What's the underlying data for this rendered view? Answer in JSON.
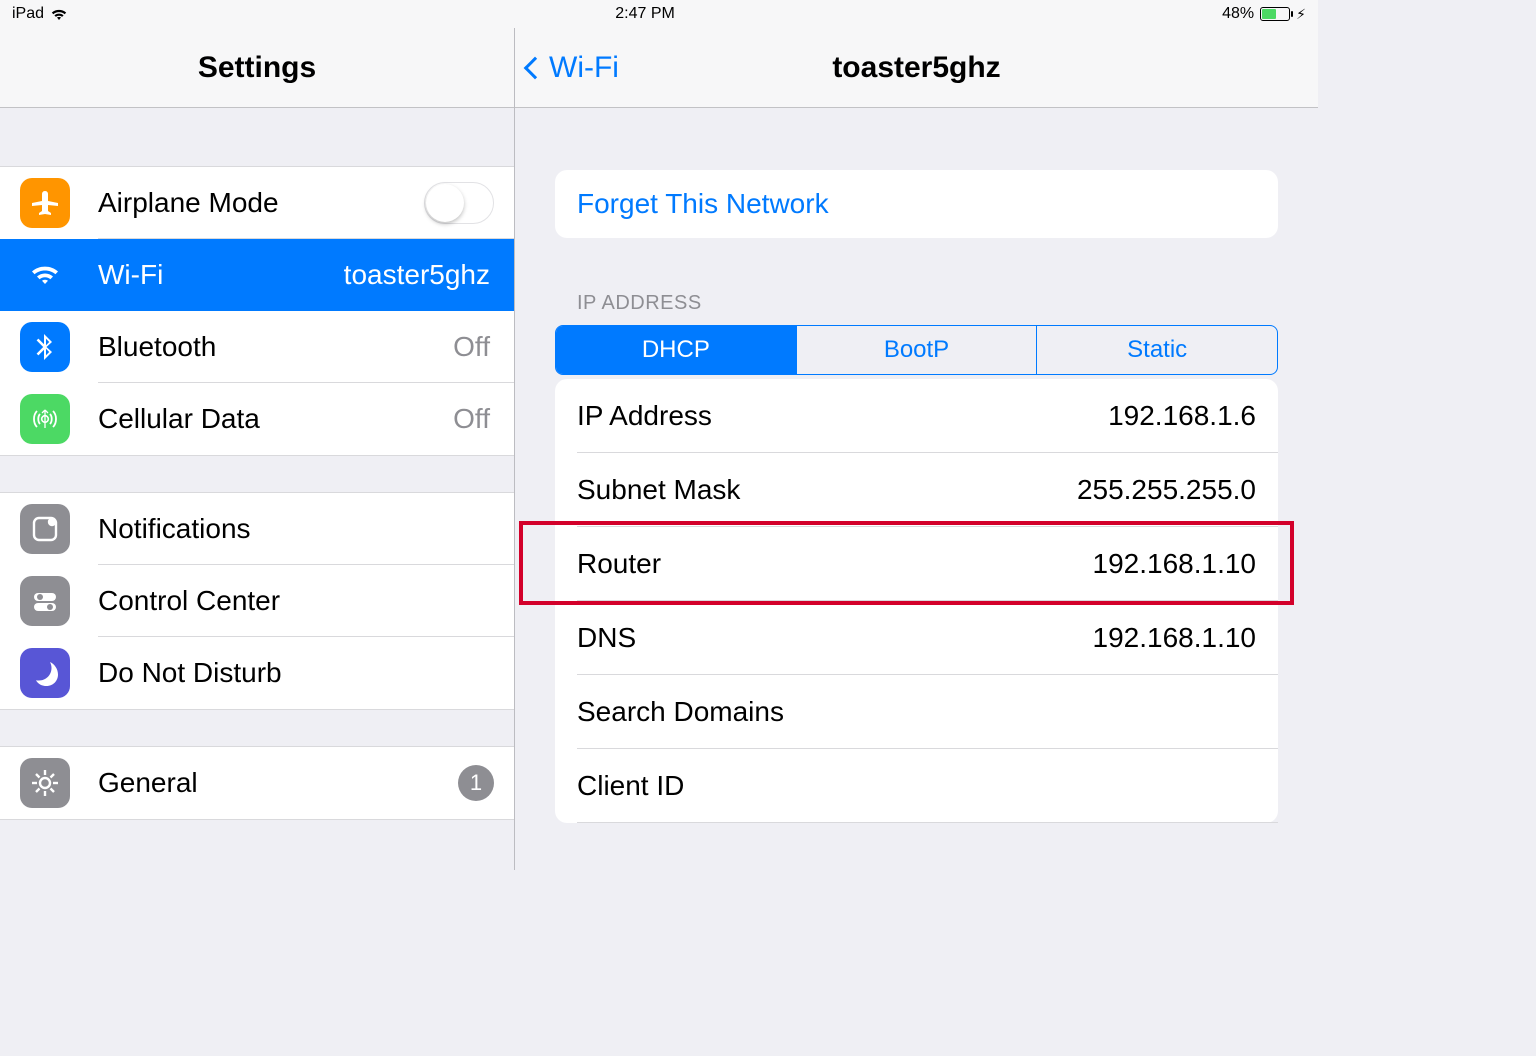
{
  "statusbar": {
    "device_label": "iPad",
    "time": "2:47 PM",
    "battery_text": "48%"
  },
  "sidebar": {
    "title": "Settings",
    "groups": [
      {
        "items": [
          {
            "name": "airplane",
            "label": "Airplane Mode",
            "value": "",
            "right": "switch",
            "selected": false,
            "icon_color": "#ff9500"
          },
          {
            "name": "wifi",
            "label": "Wi-Fi",
            "value": "toaster5ghz",
            "right": "value",
            "selected": true,
            "icon_color": "#007aff"
          },
          {
            "name": "bluetooth",
            "label": "Bluetooth",
            "value": "Off",
            "right": "value",
            "selected": false,
            "icon_color": "#007aff"
          },
          {
            "name": "cellular",
            "label": "Cellular Data",
            "value": "Off",
            "right": "value",
            "selected": false,
            "icon_color": "#4cd964"
          }
        ]
      },
      {
        "items": [
          {
            "name": "notifications",
            "label": "Notifications",
            "right": "none",
            "selected": false,
            "icon_color": "#8e8e93"
          },
          {
            "name": "controlcenter",
            "label": "Control Center",
            "right": "none",
            "selected": false,
            "icon_color": "#8e8e93"
          },
          {
            "name": "dnd",
            "label": "Do Not Disturb",
            "right": "none",
            "selected": false,
            "icon_color": "#5856d6"
          }
        ]
      },
      {
        "items": [
          {
            "name": "general",
            "label": "General",
            "right": "badge",
            "badge": "1",
            "selected": false,
            "icon_color": "#8e8e93"
          }
        ]
      }
    ]
  },
  "detail": {
    "back_label": "Wi-Fi",
    "title": "toaster5ghz",
    "forget_label": "Forget This Network",
    "ip_section_label": "IP ADDRESS",
    "segments": [
      {
        "label": "DHCP",
        "active": true
      },
      {
        "label": "BootP",
        "active": false
      },
      {
        "label": "Static",
        "active": false
      }
    ],
    "rows": [
      {
        "label": "IP Address",
        "value": "192.168.1.6"
      },
      {
        "label": "Subnet Mask",
        "value": "255.255.255.0"
      },
      {
        "label": "Router",
        "value": "192.168.1.10",
        "highlighted": true
      },
      {
        "label": "DNS",
        "value": "192.168.1.10"
      },
      {
        "label": "Search Domains",
        "value": ""
      },
      {
        "label": "Client ID",
        "value": ""
      }
    ]
  }
}
